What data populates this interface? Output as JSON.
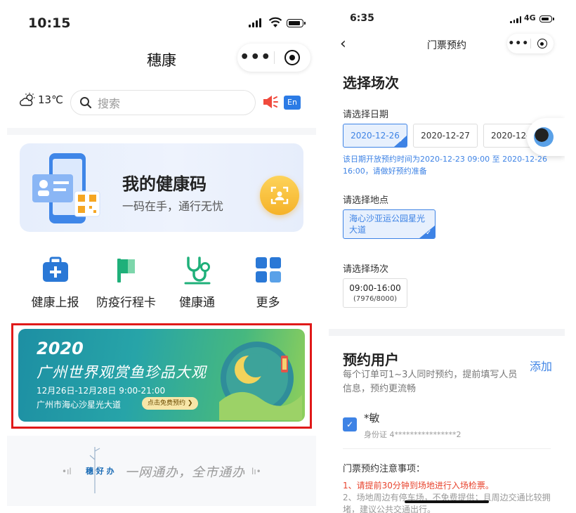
{
  "left": {
    "status": {
      "time": "10:15"
    },
    "nav": {
      "title": "穗康",
      "menu_dots": "•••"
    },
    "weather": {
      "temp": "13℃"
    },
    "search": {
      "placeholder": "搜索"
    },
    "lang_button": "En",
    "health_card": {
      "title": "我的健康码",
      "subtitle": "一码在手，通行无忧"
    },
    "grid": [
      {
        "label": "健康上报",
        "icon": "medical-kit-icon"
      },
      {
        "label": "防疫行程卡",
        "icon": "flag-icon"
      },
      {
        "label": "健康通",
        "icon": "stethoscope-icon"
      },
      {
        "label": "更多",
        "icon": "grid-icon"
      }
    ],
    "banner": {
      "year": "2020",
      "title": "广州世界观赏鱼珍品大观",
      "dates": "12月26日-12月28日  9:00-21:00",
      "place": "广州市海心沙星光大道",
      "cta": "点击免费预约 ❯"
    },
    "slogan": {
      "brand": "穗 好 办",
      "text": "一网通办，全市通办",
      "bar_left": "•ıl",
      "bar_right": "lı•"
    }
  },
  "right": {
    "status": {
      "time": "6:35",
      "network": "4G"
    },
    "nav": {
      "back": "‹",
      "title": "门票预约",
      "menu_dots": "•••"
    },
    "heading": "选择场次",
    "date_label": "请选择日期",
    "dates": [
      "2020-12-26",
      "2020-12-27",
      "2020-12-"
    ],
    "selected_date_index": 0,
    "date_note": "该日期开放预约时间为2020-12-23 09:00 至 2020-12-26 16:00，请做好预约准备",
    "location_label": "请选择地点",
    "location": "海心沙亚运公园星光大道",
    "session_label": "请选择场次",
    "session": {
      "time": "09:00-16:00",
      "capacity": "(7976/8000)"
    },
    "users": {
      "heading": "预约用户",
      "add": "添加",
      "desc": "每个订单可1~3人同时预约，提前填写人员信息，预约更流畅",
      "name": "*敏",
      "id": "身份证  4****************2"
    },
    "notice": {
      "title": "门票预约注意事项：",
      "item1": "1、请提前30分钟到场地进行入场检票。",
      "item2": "2、场地周边有停车场，不免费提供；且周边交通比较拥堵，建议公共交通出行。"
    }
  },
  "colors": {
    "accent": "#3e83e5",
    "highlight_frame": "#e01919",
    "warning": "#e8432d"
  }
}
